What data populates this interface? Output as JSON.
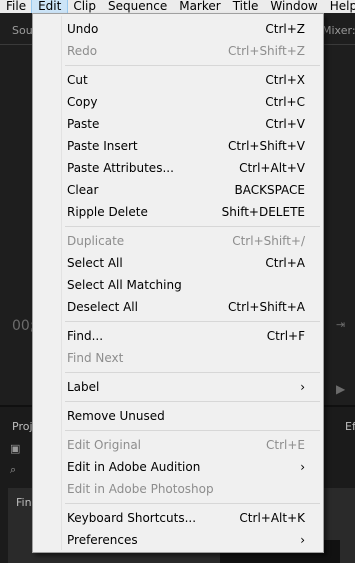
{
  "menubar": [
    "File",
    "Edit",
    "Clip",
    "Sequence",
    "Marker",
    "Title",
    "Window",
    "Help"
  ],
  "background": {
    "source_label": "Sou",
    "mixer_label": "Mixer:",
    "timecode": "00;",
    "project_label": "Proj",
    "effects_label": "Ef",
    "find_label": "Fin"
  },
  "menu": {
    "groups": [
      [
        {
          "label": "Undo",
          "shortcut": "Ctrl+Z",
          "enabled": true
        },
        {
          "label": "Redo",
          "shortcut": "Ctrl+Shift+Z",
          "enabled": false
        }
      ],
      [
        {
          "label": "Cut",
          "shortcut": "Ctrl+X",
          "enabled": true
        },
        {
          "label": "Copy",
          "shortcut": "Ctrl+C",
          "enabled": true
        },
        {
          "label": "Paste",
          "shortcut": "Ctrl+V",
          "enabled": true
        },
        {
          "label": "Paste Insert",
          "shortcut": "Ctrl+Shift+V",
          "enabled": true
        },
        {
          "label": "Paste Attributes...",
          "shortcut": "Ctrl+Alt+V",
          "enabled": true
        },
        {
          "label": "Clear",
          "shortcut": "BACKSPACE",
          "enabled": true
        },
        {
          "label": "Ripple Delete",
          "shortcut": "Shift+DELETE",
          "enabled": true
        }
      ],
      [
        {
          "label": "Duplicate",
          "shortcut": "Ctrl+Shift+/",
          "enabled": false
        },
        {
          "label": "Select All",
          "shortcut": "Ctrl+A",
          "enabled": true
        },
        {
          "label": "Select All Matching",
          "shortcut": "",
          "enabled": true
        },
        {
          "label": "Deselect All",
          "shortcut": "Ctrl+Shift+A",
          "enabled": true
        }
      ],
      [
        {
          "label": "Find...",
          "shortcut": "Ctrl+F",
          "enabled": true
        },
        {
          "label": "Find Next",
          "shortcut": "",
          "enabled": false
        }
      ],
      [
        {
          "label": "Label",
          "shortcut": "",
          "enabled": true,
          "submenu": true
        }
      ],
      [
        {
          "label": "Remove Unused",
          "shortcut": "",
          "enabled": true
        }
      ],
      [
        {
          "label": "Edit Original",
          "shortcut": "Ctrl+E",
          "enabled": false
        },
        {
          "label": "Edit in Adobe Audition",
          "shortcut": "",
          "enabled": true,
          "submenu": true
        },
        {
          "label": "Edit in Adobe Photoshop",
          "shortcut": "",
          "enabled": false
        }
      ],
      [
        {
          "label": "Keyboard Shortcuts...",
          "shortcut": "Ctrl+Alt+K",
          "enabled": true
        },
        {
          "label": "Preferences",
          "shortcut": "",
          "enabled": true,
          "submenu": true
        }
      ]
    ],
    "submenu_arrow": "›"
  }
}
